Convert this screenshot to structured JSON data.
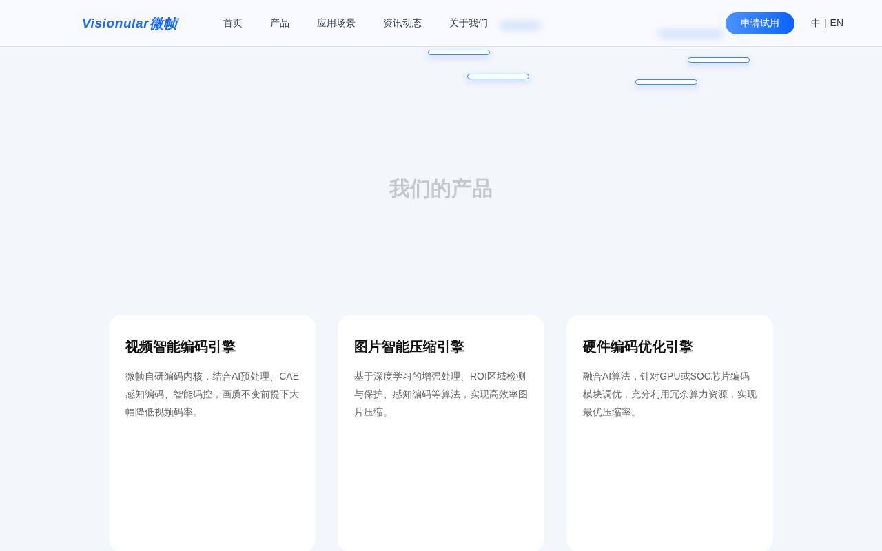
{
  "header": {
    "logo": {
      "latin": "Visionular",
      "chinese": "微帧"
    },
    "nav": [
      {
        "label": "首页"
      },
      {
        "label": "产品"
      },
      {
        "label": "应用场景"
      },
      {
        "label": "资讯动态"
      },
      {
        "label": "关于我们"
      }
    ],
    "cta_button": "申请试用",
    "language": {
      "items": [
        "中",
        "EN"
      ],
      "separator": "|"
    }
  },
  "products": {
    "title": "我们的产品",
    "cards": [
      {
        "title": "视频智能编码引擎",
        "description": "微帧自研编码内核，结合AI预处理、CAE感知编码、智能码控，画质不变前提下大幅降低视频码率。"
      },
      {
        "title": "图片智能压缩引擎",
        "description": "基于深度学习的增强处理、ROI区域检测与保护、感知编码等算法，实现高效率图片压缩。"
      },
      {
        "title": "硬件编码优化引擎",
        "description": "融合AI算法，针对GPU或SOC芯片编码模块调优，充分利用冗余算力资源，实现最优压缩率。"
      }
    ]
  }
}
